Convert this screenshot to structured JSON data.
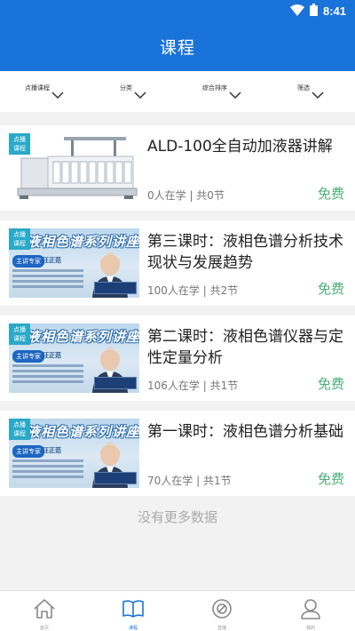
{
  "status_bar": {
    "time": "8:41",
    "wifi_icon": "wifi-icon",
    "battery_icon": "battery-icon"
  },
  "header": {
    "title": "课程"
  },
  "filters": [
    {
      "label": "点播课程",
      "icon": "chevron-down-icon"
    },
    {
      "label": "分类",
      "icon": "chevron-down-icon"
    },
    {
      "label": "综合排序",
      "icon": "chevron-down-icon"
    },
    {
      "label": "筛选",
      "icon": "chevron-down-icon"
    }
  ],
  "courses": [
    {
      "badge": "点播\n课程",
      "thumbnail": "autosampler-device-photo",
      "title": "ALD-100全自动加液器讲解",
      "meta": "0人在学 | 共0节",
      "price": "免费"
    },
    {
      "badge": "点播\n课程",
      "thumbnail": "lecture-banner",
      "thumb_title": "液相色谱系列讲座",
      "thumb_chip": "主讲专家",
      "thumb_name": "汪正范",
      "title": "第三课时：液相色谱分析技术现状与发展趋势",
      "meta": "100人在学 | 共2节",
      "price": "免费"
    },
    {
      "badge": "点播\n课程",
      "thumbnail": "lecture-banner",
      "thumb_title": "液相色谱系列讲座",
      "thumb_chip": "主讲专家",
      "thumb_name": "汪正范",
      "title": "第二课时：液相色谱仪器与定性定量分析",
      "meta": "106人在学 | 共1节",
      "price": "免费"
    },
    {
      "badge": "点播\n课程",
      "thumbnail": "lecture-banner",
      "thumb_title": "液相色谱系列讲座",
      "thumb_chip": "主讲专家",
      "thumb_name": "汪正范",
      "title": "第一课时：液相色谱分析基础",
      "meta": "70人在学 | 共1节",
      "price": "免费"
    }
  ],
  "footer_note": "没有更多数据",
  "tabs": [
    {
      "label": "首页",
      "icon": "home-icon",
      "active": false
    },
    {
      "label": "课程",
      "icon": "book-icon",
      "active": true
    },
    {
      "label": "直播",
      "icon": "live-icon",
      "active": false
    },
    {
      "label": "我的",
      "icon": "user-icon",
      "active": false
    }
  ],
  "colors": {
    "primary": "#1a73d9",
    "price": "#4cae7a",
    "badge": "#2aa9c8"
  }
}
